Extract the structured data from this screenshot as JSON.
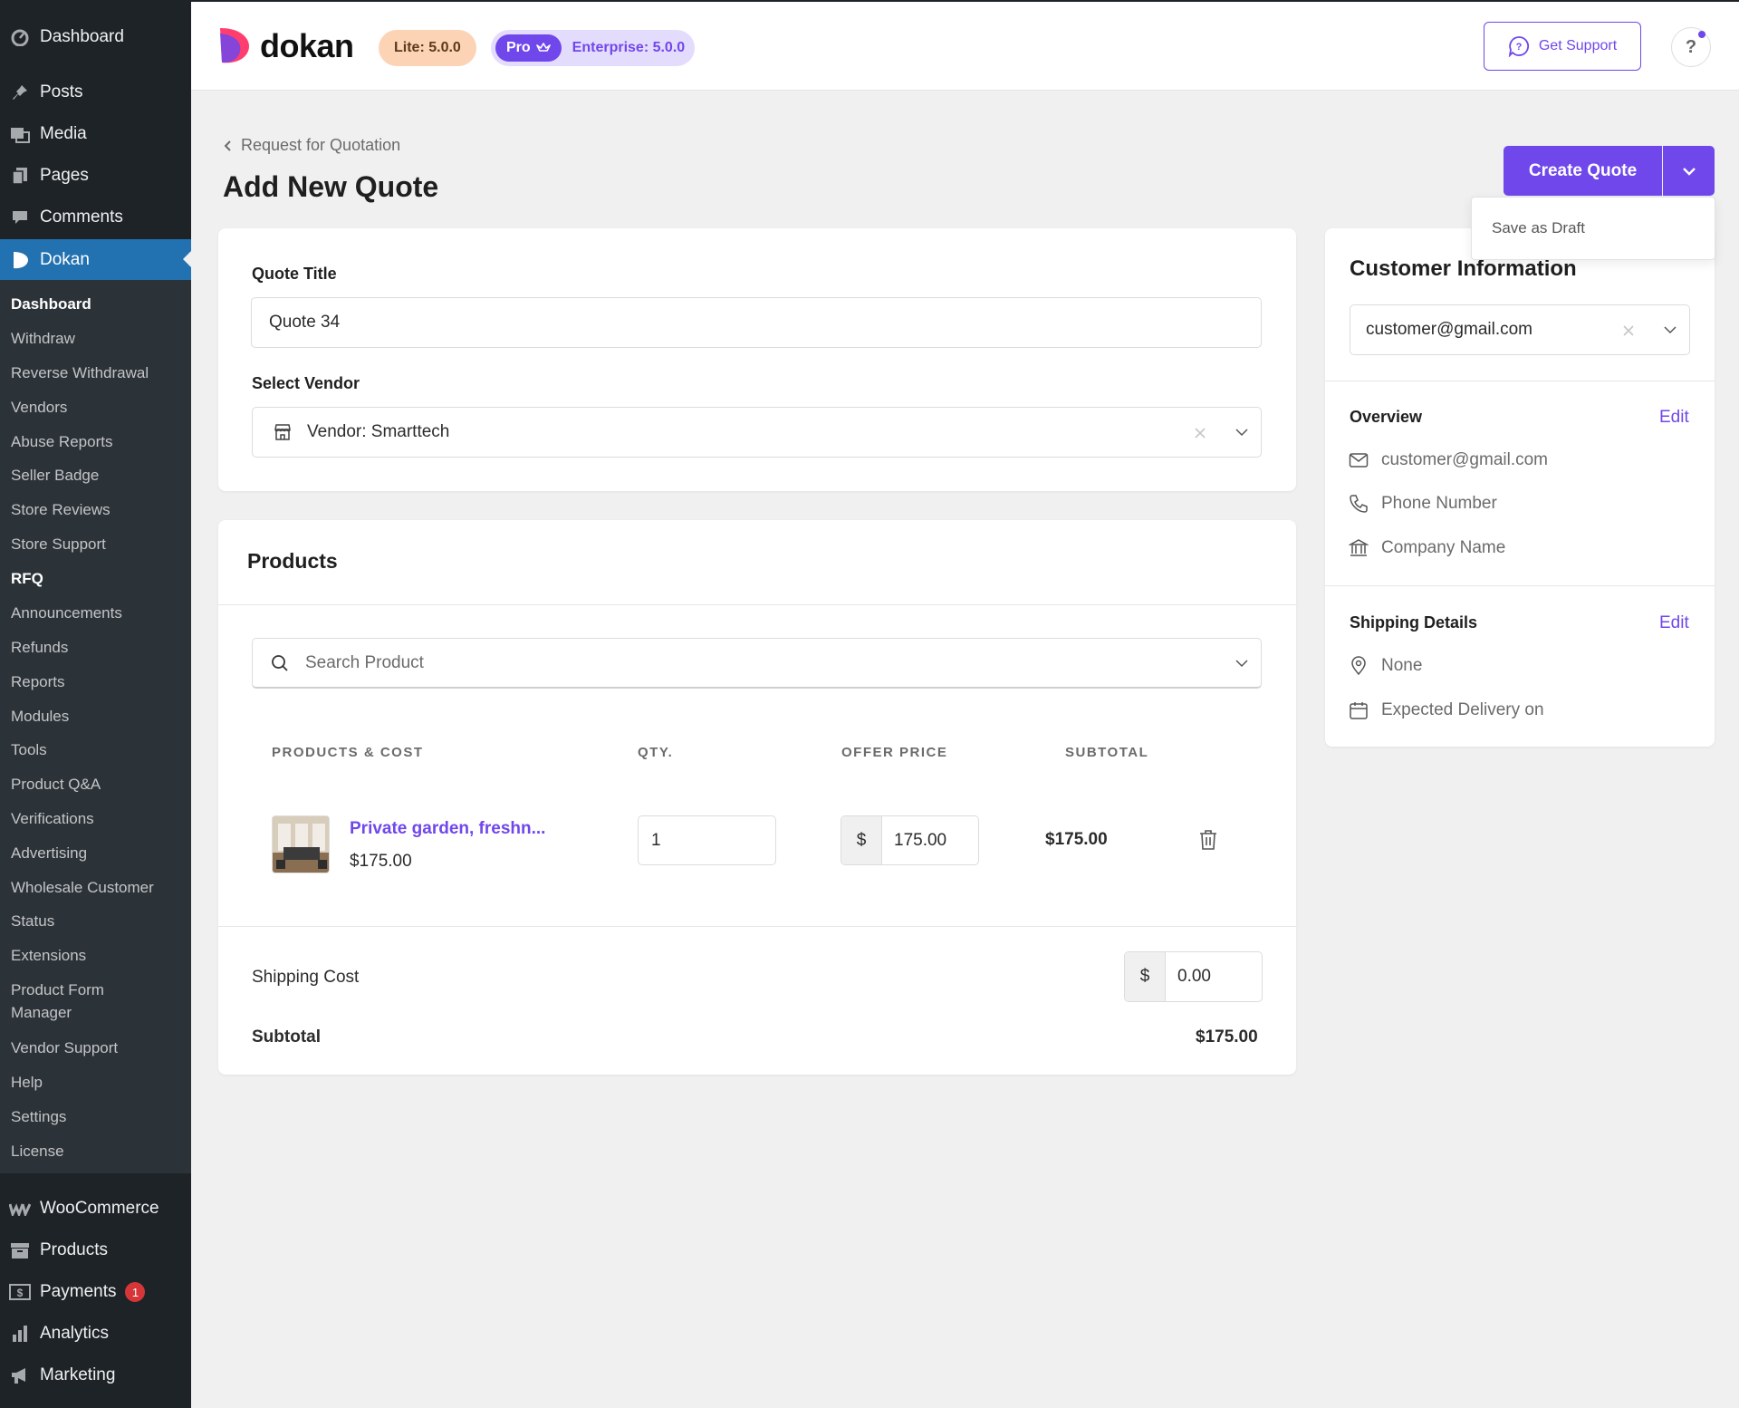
{
  "sidebar": {
    "top_items": [
      "Dashboard",
      "Posts",
      "Media",
      "Pages",
      "Comments"
    ],
    "dokan_label": "Dokan",
    "dokan_sub": [
      "Dashboard",
      "Withdraw",
      "Reverse Withdrawal",
      "Vendors",
      "Abuse Reports",
      "Seller Badge",
      "Store Reviews",
      "Store Support",
      "RFQ",
      "Announcements",
      "Refunds",
      "Reports",
      "Modules",
      "Tools",
      "Product Q&A",
      "Verifications",
      "Advertising",
      "Wholesale Customer",
      "Status",
      "Extensions",
      "Product Form Manager",
      "Vendor Support",
      "Help",
      "Settings",
      "License"
    ],
    "bottom_items": [
      "WooCommerce",
      "Products",
      "Payments",
      "Analytics",
      "Marketing"
    ],
    "payments_badge": "1"
  },
  "header": {
    "logo_text": "dokan",
    "lite_version": "Lite: 5.0.0",
    "pro_label": "Pro",
    "enterprise_version": "Enterprise: 5.0.0",
    "support_label": "Get Support",
    "help_label": "?"
  },
  "page": {
    "breadcrumb": "Request for Quotation",
    "title": "Add New Quote",
    "create_label": "Create Quote",
    "draft_label": "Save as Draft"
  },
  "quote": {
    "title_label": "Quote Title",
    "title_value": "Quote 34",
    "vendor_label": "Select Vendor",
    "vendor_value": "Vendor: Smarttech"
  },
  "products": {
    "heading": "Products",
    "search_placeholder": "Search Product",
    "columns": [
      "PRODUCTS & COST",
      "QTY.",
      "OFFER PRICE",
      "SUBTOTAL"
    ],
    "items": [
      {
        "name": "Private garden, freshn...",
        "price": "$175.00",
        "qty": "1",
        "currency": "$",
        "offer_price": "175.00",
        "subtotal": "$175.00"
      }
    ],
    "shipping_label": "Shipping Cost",
    "shipping_currency": "$",
    "shipping_value": "0.00",
    "subtotal_label": "Subtotal",
    "subtotal_value": "$175.00"
  },
  "customer": {
    "heading": "Customer Information",
    "selected": "customer@gmail.com",
    "overview_label": "Overview",
    "edit_label": "Edit",
    "email": "customer@gmail.com",
    "phone": "Phone Number",
    "company": "Company Name",
    "shipping_label": "Shipping Details",
    "address": "None",
    "delivery": "Expected Delivery on"
  },
  "colors": {
    "accent": "#7047eb",
    "sidebar": "#1d2327",
    "active": "#2271b1"
  }
}
